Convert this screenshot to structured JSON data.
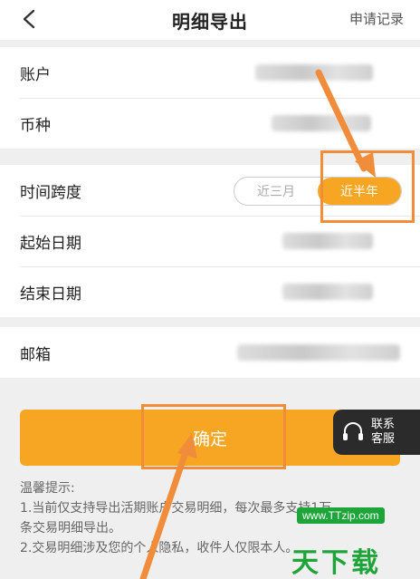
{
  "header": {
    "title": "明细导出",
    "apply_records": "申请记录"
  },
  "account_group": {
    "account_label": "账户",
    "currency_label": "币种"
  },
  "time_group": {
    "span_label": "时间跨度",
    "options": [
      "近三月",
      "近半年"
    ],
    "selected": "近半年",
    "start_label": "起始日期",
    "end_label": "结束日期"
  },
  "email_group": {
    "email_label": "邮箱"
  },
  "actions": {
    "confirm_label": "确定"
  },
  "support": {
    "label": "联系客服"
  },
  "tips": {
    "title": "温馨提示:",
    "line1": "1.当前仅支持导出活期账户交易明细，每次最多支持1万",
    "line1b": "条交易明细导出。",
    "line2": "2.交易明细涉及您的个人隐私，收件人仅限本人。"
  },
  "watermark": {
    "url": "www.TTzip.com",
    "brand": "天下载"
  },
  "colors": {
    "accent": "#f6a623",
    "highlight": "#f08c3a",
    "watermark": "#1ea53a"
  }
}
